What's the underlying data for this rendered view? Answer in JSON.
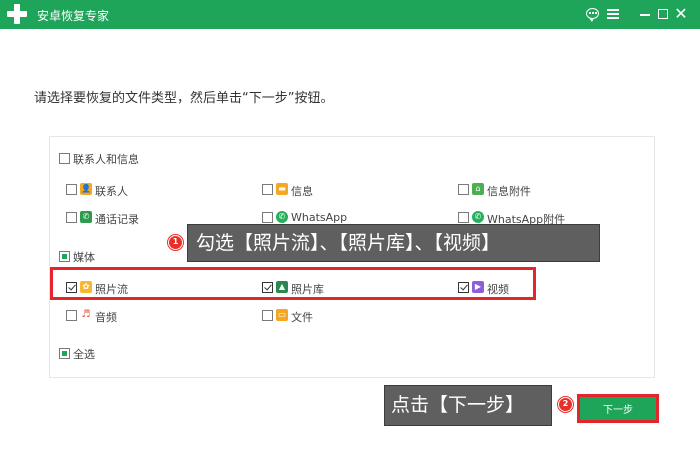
{
  "window": {
    "title": "安卓恢复专家",
    "controls": {
      "minimize": "—",
      "maximize": "",
      "close": "✕"
    }
  },
  "instruction": "请选择要恢复的文件类型，然后单击“下一步”按钮。",
  "groups": {
    "contacts": {
      "label": "联系人和信息",
      "items": [
        {
          "label": "联系人",
          "icon": "contact-icon",
          "color": "#f5a623",
          "checked": false
        },
        {
          "label": "信息",
          "icon": "message-icon",
          "color": "#f5a623",
          "checked": false
        },
        {
          "label": "信息附件",
          "icon": "attachment-icon",
          "color": "#4caf50",
          "checked": false
        },
        {
          "label": "通话记录",
          "icon": "call-log-icon",
          "color": "#2e9b4f",
          "checked": false
        },
        {
          "label": "WhatsApp",
          "icon": "whatsapp-icon",
          "color": "#25b15c",
          "checked": false
        },
        {
          "label": "WhatsApp附件",
          "icon": "whatsapp-attachment-icon",
          "color": "#25b15c",
          "checked": false
        }
      ]
    },
    "media": {
      "label": "媒体",
      "items": [
        {
          "label": "照片流",
          "icon": "photo-stream-icon",
          "color": "#f7b733",
          "checked": true
        },
        {
          "label": "照片库",
          "icon": "photo-library-icon",
          "color": "#2a8a4e",
          "checked": true
        },
        {
          "label": "视频",
          "icon": "video-icon",
          "color": "#8e5fd6",
          "checked": true
        },
        {
          "label": "音频",
          "icon": "audio-icon",
          "color": "#e94b35",
          "checked": false
        },
        {
          "label": "文件",
          "icon": "folder-icon",
          "color": "#f5a623",
          "checked": false
        }
      ]
    }
  },
  "select_all": "全选",
  "callouts": [
    {
      "step": "1",
      "text": "勾选【照片流】、【照片库】、【视频】"
    },
    {
      "step": "2",
      "text": "点击【下一步】"
    }
  ],
  "next_button": "下一步",
  "colors": {
    "brand": "#1fa55a",
    "highlight": "#e2262b",
    "badge": "#e8302a",
    "callout_bg": "#5f5f5f"
  }
}
